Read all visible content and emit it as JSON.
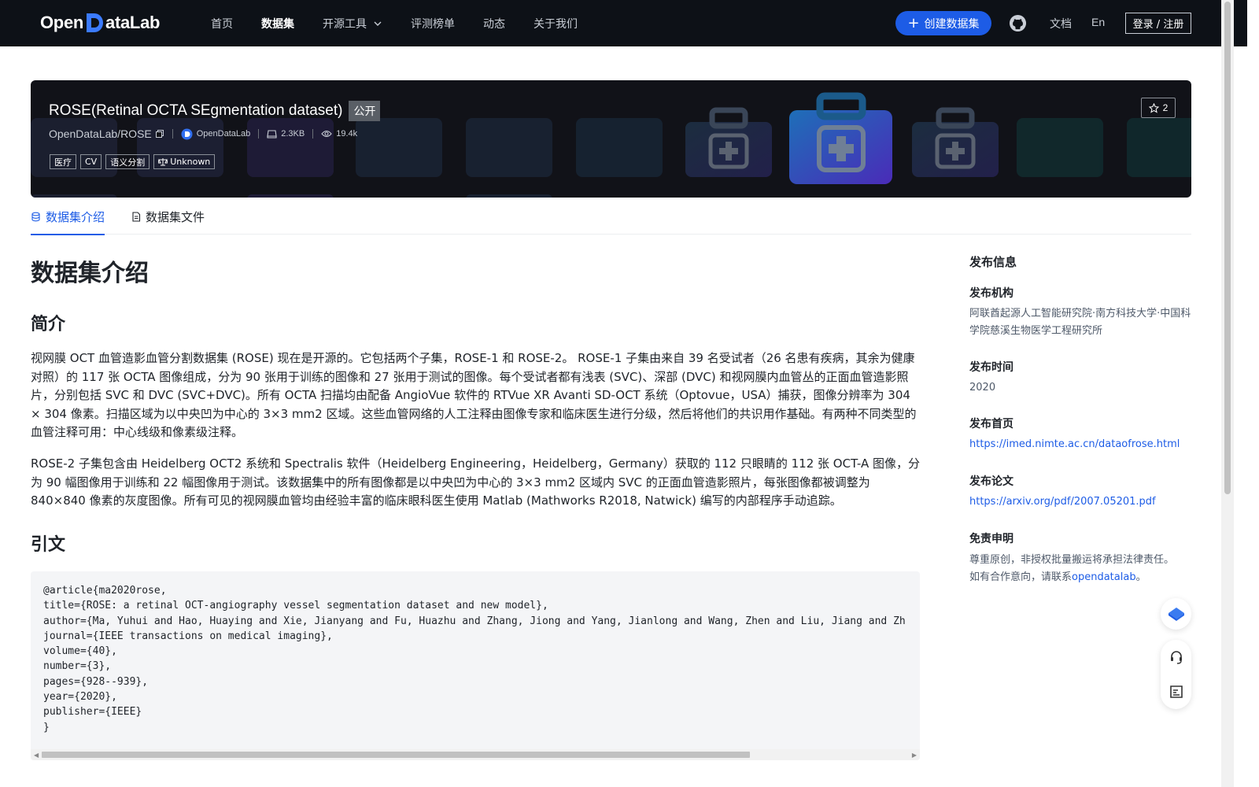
{
  "header": {
    "logo_text_left": "Open",
    "logo_text_right": "ataLab",
    "nav": [
      "首页",
      "数据集",
      "开源工具",
      "评测榜单",
      "动态",
      "关于我们"
    ],
    "create_label": "创建数据集",
    "docs_label": "文档",
    "lang_label": "En",
    "login_label": "登录 / 注册"
  },
  "dataset": {
    "title": "ROSE(Retinal OCTA SEgmentation dataset)",
    "visibility": "公开",
    "repo": "OpenDataLab/ROSE",
    "publisher": "OpenDataLab",
    "size": "2.3KB",
    "views": "19.4k",
    "tags": [
      "医疗",
      "CV",
      "语义分割"
    ],
    "license": "Unknown",
    "stars": "2"
  },
  "tabs": [
    "数据集介绍",
    "数据集文件"
  ],
  "content": {
    "heading": "数据集介绍",
    "intro_heading": "简介",
    "para1": "视网膜 OCT 血管造影血管分割数据集 (ROSE) 现在是开源的。它包括两个子集，ROSE-1 和 ROSE-2。 ROSE-1 子集由来自 39 名受试者（26 名患有疾病，其余为健康对照）的 117 张 OCTA 图像组成，分为 90 张用于训练的图像和 27 张用于测试的图像。每个受试者都有浅表 (SVC)、深部 (DVC) 和视网膜内血管丛的正面血管造影照片，分别包括 SVC 和 DVC (SVC+DVC)。所有 OCTA 扫描均由配备 AngioVue 软件的 RTVue XR Avanti SD-OCT 系统（Optovue，USA）捕获，图像分辨率为 304 × 304 像素。扫描区域为以中央凹为中心的 3×3 mm2 区域。这些血管网络的人工注释由图像专家和临床医生进行分级，然后将他们的共识用作基础。有两种不同类型的血管注释可用：中心线级和像素级注释。",
    "para2": "ROSE-2 子集包含由 Heidelberg OCT2 系统和 Spectralis 软件（Heidelberg Engineering，Heidelberg，Germany）获取的 112 只眼睛的 112 张 OCT-A 图像，分为 90 幅图像用于训练和 22 幅图像用于测试。该数据集中的所有图像都是以中央凹为中心的 3×3 mm2 区域内 SVC 的正面血管造影照片，每张图像都被调整为 840×840 像素的灰度图像。所有可见的视网膜血管均由经验丰富的临床眼科医生使用 Matlab (Mathworks R2018, Natwick) 编写的内部程序手动追踪。",
    "citation_heading": "引文",
    "citation": "@article{ma2020rose,\ntitle={ROSE: a retinal OCT-angiography vessel segmentation dataset and new model},\nauthor={Ma, Yuhui and Hao, Huaying and Xie, Jianyang and Fu, Huazhu and Zhang, Jiong and Yang, Jianlong and Wang, Zhen and Liu, Jiang and Zh\njournal={IEEE transactions on medical imaging},\nvolume={40},\nnumber={3},\npages={928--939},\nyear={2020},\npublisher={IEEE}\n}"
  },
  "sidebar": {
    "heading": "发布信息",
    "org_label": "发布机构",
    "org_value": "阿联酋起源人工智能研究院·南方科技大学·中国科学院慈溪生物医学工程研究所",
    "time_label": "发布时间",
    "time_value": "2020",
    "home_label": "发布首页",
    "home_value": "https://imed.nimte.ac.cn/dataofrose.html",
    "paper_label": "发布论文",
    "paper_value": "https://arxiv.org/pdf/2007.05201.pdf",
    "disclaimer_label": "免责申明",
    "disclaimer_text1": "尊重原创，非授权批量搬运将承担法律责任。",
    "disclaimer_text2": "如有合作意向，请联系",
    "disclaimer_link": "opendatalab",
    "disclaimer_end": "。"
  },
  "colors": {
    "accent": "#1d5ce6",
    "topbar": "#0d1117"
  }
}
